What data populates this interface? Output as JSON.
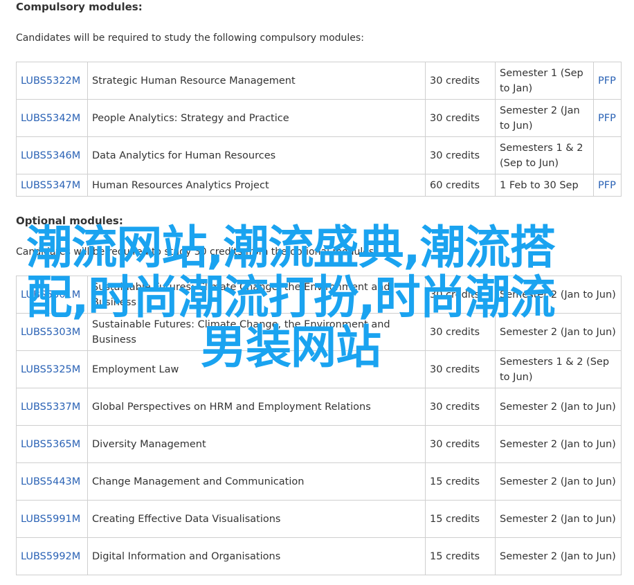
{
  "compulsory": {
    "title": "Compulsory modules:",
    "intro": "Candidates will be required to study the following compulsory modules:",
    "rows": [
      {
        "code": "LUBS5322M",
        "name": "Strategic Human Resource Management",
        "credits": "30 credits",
        "semester": "Semester 1 (Sep to Jan)",
        "pfp": "PFP"
      },
      {
        "code": "LUBS5342M",
        "name": "People Analytics: Strategy and Practice",
        "credits": "30 credits",
        "semester": "Semester 2 (Jan to Jun)",
        "pfp": "PFP"
      },
      {
        "code": "LUBS5346M",
        "name": "Data Analytics for Human Resources",
        "credits": "30 credits",
        "semester": "Semesters 1 & 2 (Sep to Jun)",
        "pfp": ""
      },
      {
        "code": "LUBS5347M",
        "name": "Human Resources Analytics Project",
        "credits": "60 credits",
        "semester": "1 Feb to 30 Sep",
        "pfp": "PFP"
      }
    ]
  },
  "optional": {
    "title": "Optional modules:",
    "intro": "Candidates will be required to study 30 credits from the optional modules",
    "rows": [
      {
        "code": "LUBS5301M",
        "name": "Sustainable Futures: Climate Change, the Environment and Business",
        "credits": "30 credits",
        "semester": "Semester 2 (Jan to Jun)"
      },
      {
        "code": "LUBS5303M",
        "name": "Sustainable Futures: Climate Change, the Environment and Business",
        "credits": "30 credits",
        "semester": "Semester 2 (Jan to Jun)"
      },
      {
        "code": "LUBS5325M",
        "name": "Employment Law",
        "credits": "30 credits",
        "semester": "Semesters 1 & 2 (Sep to Jun)"
      },
      {
        "code": "LUBS5337M",
        "name": "Global Perspectives on HRM and Employment Relations",
        "credits": "30 credits",
        "semester": "Semester 2 (Jan to Jun)"
      },
      {
        "code": "LUBS5365M",
        "name": "Diversity Management",
        "credits": "30 credits",
        "semester": "Semester 2 (Jan to Jun)"
      },
      {
        "code": "LUBS5443M",
        "name": "Change Management and Communication",
        "credits": "15 credits",
        "semester": "Semester 2 (Jan to Jun)"
      },
      {
        "code": "LUBS5991M",
        "name": "Creating Effective Data Visualisations",
        "credits": "15 credits",
        "semester": "Semester 2 (Jan to Jun)"
      },
      {
        "code": "LUBS5992M",
        "name": "Digital Information and Organisations",
        "credits": "15 credits",
        "semester": "Semester 2 (Jan to Jun)"
      }
    ]
  },
  "watermark": "潮流网站,潮流盛典,潮流搭配,时尚潮流打扮,时尚潮流男装网站",
  "colors": {
    "link": "#2a62b5",
    "watermark": "#1aa3f0",
    "border": "#cfcfcf"
  }
}
